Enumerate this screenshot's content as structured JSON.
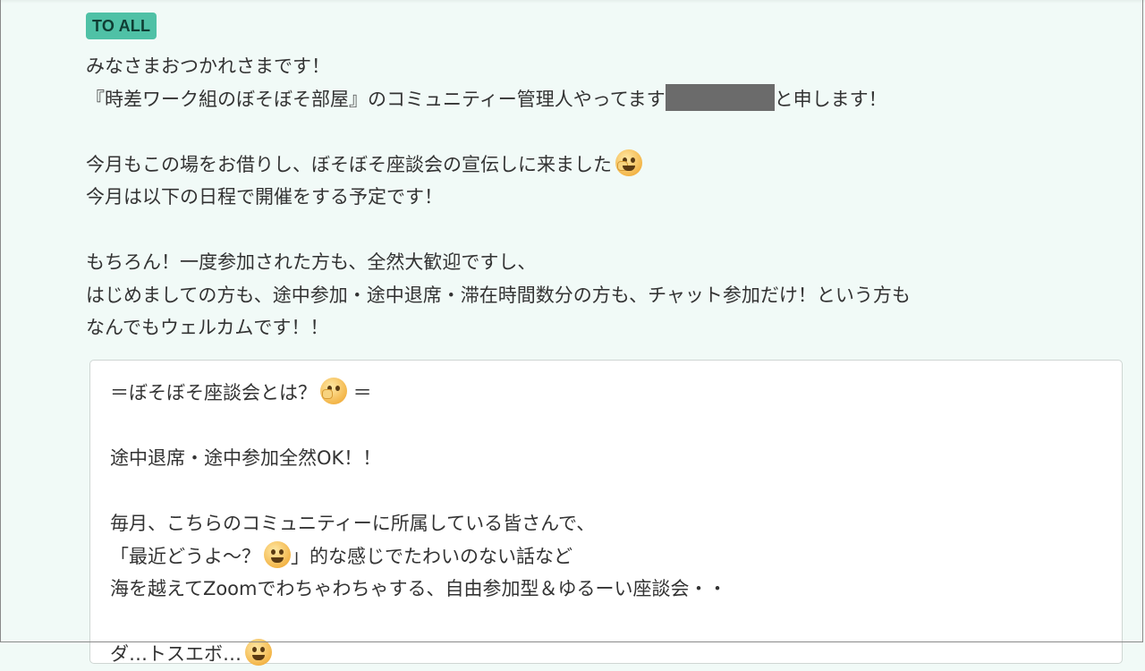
{
  "badge": "TO ALL",
  "message": {
    "line1": "みなさまおつかれさまです！",
    "line2_before": "『時差ワーク組のぼそぼそ部屋』のコミュニティー管理人やってます",
    "line2_after": "と申します！",
    "line4": "今月もこの場をお借りし、ぼそぼそ座談会の宣伝しに来ました",
    "line4_emoji": "thinking-salute-emoji",
    "line5": "今月は以下の日程で開催をする予定です！",
    "line7": "もちろん！一度参加された方も、全然大歓迎ですし、",
    "line8": "はじめましての方も、途中参加・途中退席・滞在時間数分の方も、チャット参加だけ！という方も",
    "line9": "なんでもウェルカムです！！"
  },
  "quote": {
    "heading_before": "＝ぼそぼそ座談会とは？",
    "heading_emoji": "thinking-emoji",
    "heading_after": " ＝",
    "line2": "途中退席・途中参加全然OK！！",
    "line4": "毎月、こちらのコミュニティーに所属している皆さんで、",
    "line5_before": "「最近どうよ～？",
    "line5_emoji": "grin-emoji",
    "line5_after": "」的な感じでたわいのない話など",
    "line6": "海を越えてZoomでわちゃわちゃする、自由参加型＆ゆるーい座談会・・",
    "line8_partial": "ダ…トスエボ…",
    "line8_emoji": "smile-emoji"
  },
  "colors": {
    "background": "#f1faf7",
    "badge": "#4fc1a6",
    "redaction": "#6b6b6b"
  }
}
